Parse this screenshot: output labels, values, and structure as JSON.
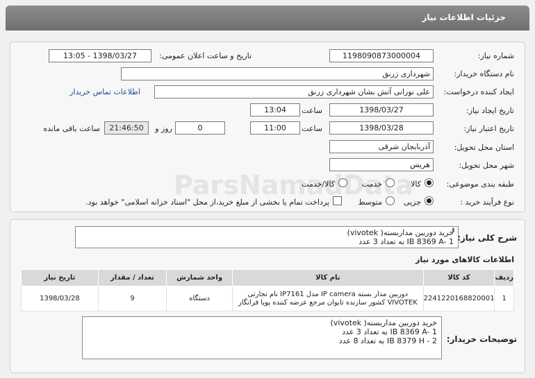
{
  "header": {
    "title": "جزئیات اطلاعات نیاز"
  },
  "fields": {
    "need_number_label": "شماره نیاز:",
    "need_number": "1198090873000004",
    "announce_label": "تاریخ و ساعت اعلان عمومی:",
    "announce_value": "1398/03/27 - 13:05",
    "buyer_org_label": "نام دستگاه خریدار:",
    "buyer_org": "شهرداری زرنق",
    "creator_label": "ایجاد کننده درخواست:",
    "creator": "علی نورانی آتش بشان  شهرداری زرنق",
    "contact_link": "اطلاعات تماس خریدار",
    "created_date_label": "تاریخ ایجاد نیاز:",
    "created_date": "1398/03/27",
    "created_time_label": "ساعت",
    "created_time": "13:04",
    "validity_label": "تاریخ اعتبار نیاز:",
    "validity_date": "1398/03/28",
    "validity_time_label": "ساعت",
    "validity_time": "11:00",
    "days_value": "0",
    "days_label": "روز و",
    "remaining_time": "21:46:50",
    "remaining_label": "ساعت باقی مانده",
    "province_label": "استان محل تحویل:",
    "province": "آذربایجان شرقی",
    "city_label": "شهر محل تحویل:",
    "city": "هریس",
    "category_label": "طبقه بندی موضوعی:",
    "category_options": [
      "کالا",
      "خدمت",
      "کالا/خدمت"
    ],
    "purchase_type_label": "نوع فرآیند خرید :",
    "purchase_options": [
      "جزیی",
      "متوسط"
    ],
    "treasury_text": "پرداخت تمام یا بخشی از مبلغ خرید،از محل \"اسناد خزانه اسلامی\" خواهد بود."
  },
  "summary": {
    "label": "شرح کلی نیاز:",
    "text": "خرید دوربین مداربسته( vivotek)\nIB 8369 A- 1  به تعداد 3 عدد"
  },
  "goods": {
    "section_title": "اطلاعات کالاهای مورد نیاز",
    "columns": [
      "ردیف",
      "کد کالا",
      "نام کالا",
      "واحد شمارش",
      "تعداد / مقدار",
      "تاریخ نیاز"
    ],
    "rows": [
      {
        "row": "1",
        "code": "2241220168820001",
        "name": "دوربین مدار بسته IP camera مدل IP7161 نام تجارتی\nVIVOTEK کشور سازنده تایوان مرجع عرضه کننده پویا فرانگار",
        "unit": "دستگاه",
        "qty": "9",
        "date": "1398/03/28"
      }
    ]
  },
  "buyer_notes": {
    "label": "توضیحات خریدار:",
    "text": "خرید دوربین مداربسته( vivotek)\nIB 8369 A- 1  به تعداد 3 عدد\nIB 8379 H - 2  به تعداد 8 عدد"
  },
  "watermark": {
    "text": "ParsNamadData"
  }
}
